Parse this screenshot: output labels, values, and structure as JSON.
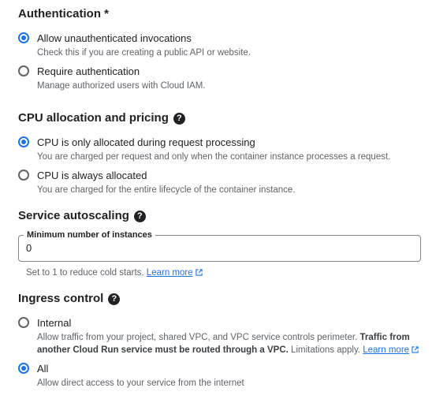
{
  "authentication": {
    "title": "Authentication *",
    "options": [
      {
        "label": "Allow unauthenticated invocations",
        "description": "Check this if you are creating a public API or website.",
        "selected": true
      },
      {
        "label": "Require authentication",
        "description": "Manage authorized users with Cloud IAM.",
        "selected": false
      }
    ]
  },
  "cpu": {
    "title": "CPU allocation and pricing",
    "help_icon": "?",
    "options": [
      {
        "label": "CPU is only allocated during request processing",
        "description": "You are charged per request and only when the container instance processes a request.",
        "selected": true
      },
      {
        "label": "CPU is always allocated",
        "description": "You are charged for the entire lifecycle of the container instance.",
        "selected": false
      }
    ]
  },
  "autoscaling": {
    "title": "Service autoscaling",
    "help_icon": "?",
    "field_label": "Minimum number of instances",
    "field_value": "0",
    "hint": "Set to 1 to reduce cold starts.",
    "hint_link": "Learn more"
  },
  "ingress": {
    "title": "Ingress control",
    "help_icon": "?",
    "options": [
      {
        "label": "Internal",
        "description_part1": "Allow traffic from your project, shared VPC, and VPC service controls perimeter.",
        "description_bold": "Traffic from another Cloud Run service must be routed through a VPC.",
        "description_part2": "Limitations apply.",
        "link": "Learn more",
        "selected": false
      },
      {
        "label": "All",
        "description": "Allow direct access to your service from the internet",
        "selected": true
      }
    ]
  },
  "colors": {
    "accent": "#1a73e8",
    "text": "#202124",
    "secondary_text": "#5f6368"
  },
  "icons": {
    "help": "help-circle-icon",
    "external_link": "open-in-new-icon"
  }
}
